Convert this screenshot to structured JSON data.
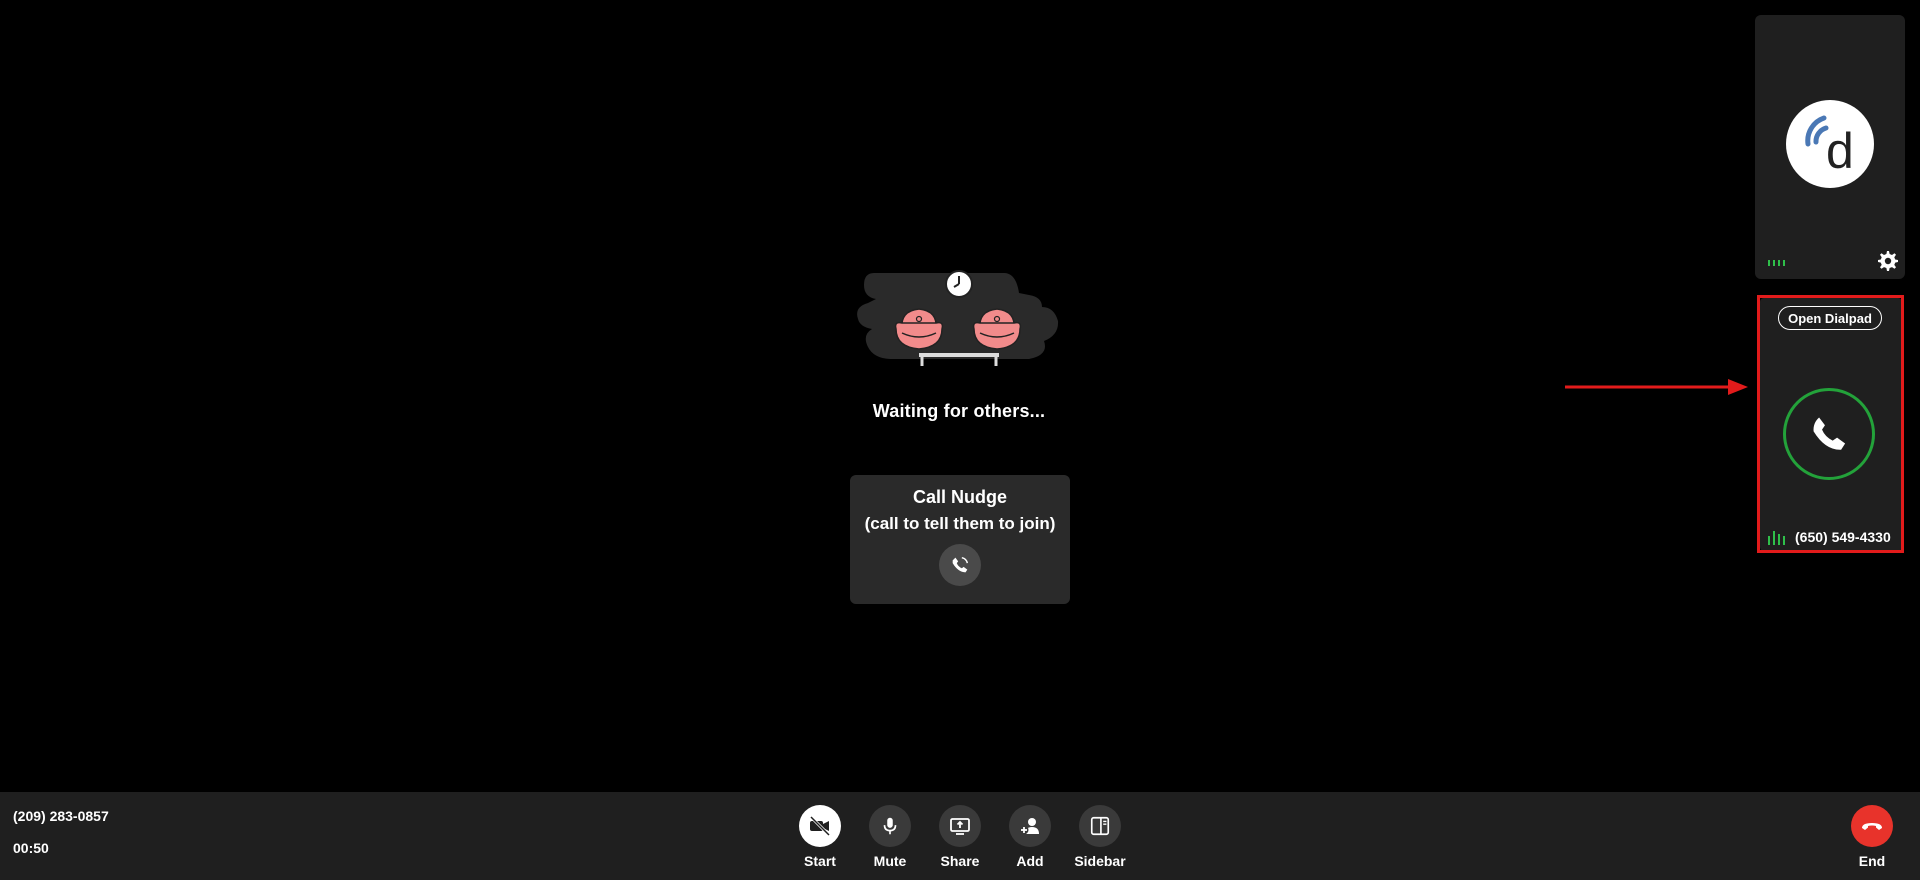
{
  "main": {
    "waiting_text": "Waiting for others...",
    "nudge": {
      "title": "Call Nudge",
      "subtitle": "(call to tell them to join)"
    }
  },
  "participants": {
    "self": {
      "avatar_letter": "d",
      "icons": [
        "dialpad-logo-icon",
        "audio-level-icon",
        "gear-icon"
      ]
    },
    "outgoing_call": {
      "open_dialpad_label": "Open Dialpad",
      "phone_number": "(650) 549-4330",
      "status_color": "#23a23a",
      "icons": [
        "phone-icon",
        "audio-level-icon"
      ]
    }
  },
  "controlbar": {
    "caller_number": "(209) 283-0857",
    "timer": "00:50",
    "controls": [
      {
        "label": "Start",
        "icon": "video-off-icon"
      },
      {
        "label": "Mute",
        "icon": "microphone-icon"
      },
      {
        "label": "Share",
        "icon": "share-screen-icon"
      },
      {
        "label": "Add",
        "icon": "add-person-icon"
      },
      {
        "label": "Sidebar",
        "icon": "sidebar-icon"
      }
    ],
    "end": {
      "label": "End",
      "icon": "hang-up-icon",
      "color": "#e8332b"
    }
  },
  "colors": {
    "background": "#000000",
    "panel": "#1f1f1f",
    "highlight": "#e21b1b",
    "accent_green": "#23a23a"
  }
}
